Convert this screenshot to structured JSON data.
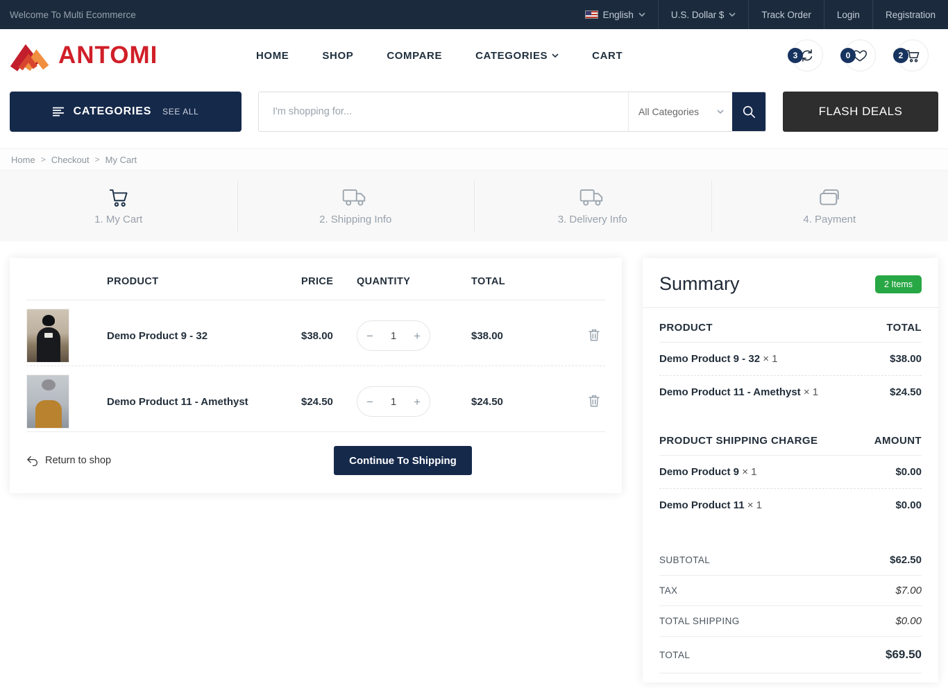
{
  "topbar": {
    "welcome": "Welcome To Multi Ecommerce",
    "language": "English",
    "currency": "U.S. Dollar $",
    "links": [
      "Track Order",
      "Login",
      "Registration"
    ]
  },
  "header": {
    "brand": "ANTOMI",
    "nav": [
      {
        "label": "HOME"
      },
      {
        "label": "SHOP"
      },
      {
        "label": "COMPARE"
      },
      {
        "label": "CATEGORIES"
      },
      {
        "label": "CART"
      }
    ],
    "actions": {
      "compare_count": "3",
      "wishlist_count": "0",
      "cart_count": "2"
    }
  },
  "search": {
    "categories_label": "CATEGORIES",
    "see_all": "SEE ALL",
    "placeholder": "I'm shopping for...",
    "category_select": "All Categories",
    "flash_deals": "FLASH DEALS"
  },
  "breadcrumb": {
    "items": [
      "Home",
      "Checkout",
      "My Cart"
    ],
    "separator": ">"
  },
  "steps": [
    {
      "label": "1. My Cart"
    },
    {
      "label": "2. Shipping Info"
    },
    {
      "label": "3. Delivery Info"
    },
    {
      "label": "4. Payment"
    }
  ],
  "cart": {
    "columns": [
      "PRODUCT",
      "PRICE",
      "QUANTITY",
      "TOTAL"
    ],
    "items": [
      {
        "name": "Demo Product 9 - 32",
        "price": "$38.00",
        "qty": "1",
        "total": "$38.00"
      },
      {
        "name": "Demo Product 11 - Amethyst",
        "price": "$24.50",
        "qty": "1",
        "total": "$24.50"
      }
    ],
    "controls": {
      "minus": "−",
      "plus": "+"
    },
    "return_label": "Return to shop",
    "continue_label": "Continue To Shipping"
  },
  "summary": {
    "title": "Summary",
    "badge": "2 Items",
    "col_product": "PRODUCT",
    "col_total": "TOTAL",
    "items": [
      {
        "name": "Demo Product 9 - 32",
        "qty": "× 1",
        "total": "$38.00"
      },
      {
        "name": "Demo Product 11 - Amethyst",
        "qty": "× 1",
        "total": "$24.50"
      }
    ],
    "shipping_title": "PRODUCT SHIPPING CHARGE",
    "shipping_amount": "AMOUNT",
    "shipping_items": [
      {
        "name": "Demo Product 9",
        "qty": "× 1",
        "amount": "$0.00"
      },
      {
        "name": "Demo Product 11",
        "qty": "× 1",
        "amount": "$0.00"
      }
    ],
    "totals": {
      "subtotal": {
        "label": "SUBTOTAL",
        "value": "$62.50"
      },
      "tax": {
        "label": "TAX",
        "value": "$7.00"
      },
      "shipping": {
        "label": "TOTAL SHIPPING",
        "value": "$0.00"
      },
      "total": {
        "label": "TOTAL",
        "value": "$69.50"
      }
    }
  },
  "colors": {
    "navy_dark": "#1b2b3d",
    "navy_accent": "#15294b",
    "badge_navy": "#17335f",
    "brand_red": "#d01f28",
    "flash_dark": "#2e2e2e",
    "success_green": "#28a745"
  }
}
